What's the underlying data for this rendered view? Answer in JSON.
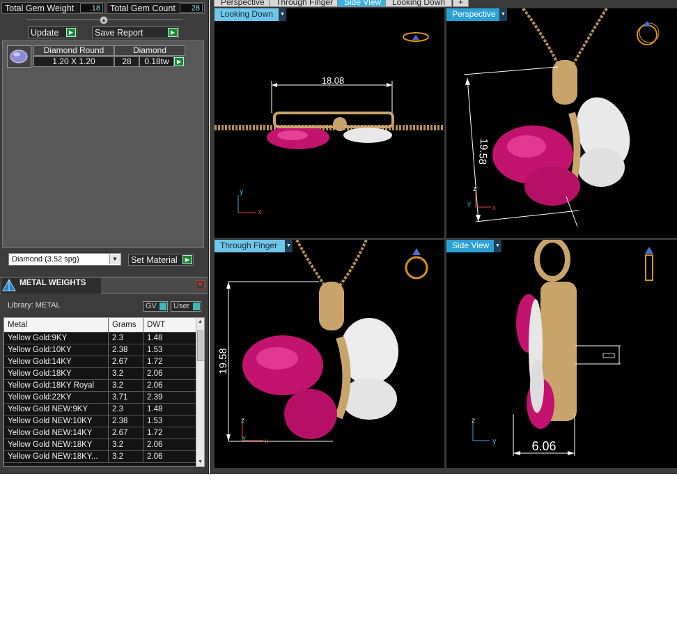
{
  "stats": {
    "total_weight_label": "Total Gem Weight",
    "total_weight_value": ".18",
    "total_count_label": "Total Gem Count",
    "total_count_value": "28"
  },
  "buttons": {
    "update": "Update",
    "save_report": "Save Report",
    "set_material": "Set Material"
  },
  "gem": {
    "shape": "Diamond Round",
    "type": "Diamond",
    "size": "1.20 X 1.20",
    "count": "28",
    "weight": "0.18tw"
  },
  "material_select": {
    "value": "Diamond     (3.52 spg)"
  },
  "metal_weights": {
    "title": "METAL WEIGHTS",
    "library_label": "Library: METAL",
    "gv_label": "GV",
    "user_label": "User",
    "columns": [
      "Metal",
      "Grams",
      "DWT"
    ],
    "rows": [
      {
        "metal": "Yellow Gold:9KY",
        "grams": "2.3",
        "dwt": "1.48"
      },
      {
        "metal": "Yellow Gold:10KY",
        "grams": "2.38",
        "dwt": "1.53"
      },
      {
        "metal": "Yellow Gold:14KY",
        "grams": "2.67",
        "dwt": "1.72"
      },
      {
        "metal": "Yellow Gold:18KY",
        "grams": "3.2",
        "dwt": "2.06"
      },
      {
        "metal": "Yellow Gold:18KY Royal",
        "grams": "3.2",
        "dwt": "2.06"
      },
      {
        "metal": "Yellow Gold:22KY",
        "grams": "3.71",
        "dwt": "2.39"
      },
      {
        "metal": "Yellow Gold NEW:9KY",
        "grams": "2.3",
        "dwt": "1.48"
      },
      {
        "metal": "Yellow Gold NEW:10KY",
        "grams": "2.38",
        "dwt": "1.53"
      },
      {
        "metal": "Yellow Gold NEW:14KY",
        "grams": "2.67",
        "dwt": "1.72"
      },
      {
        "metal": "Yellow Gold NEW:18KY",
        "grams": "3.2",
        "dwt": "2.06"
      },
      {
        "metal": "Yellow Gold NEW:18KY...",
        "grams": "3.2",
        "dwt": "2.06"
      }
    ]
  },
  "top_tabs": [
    "Perspective",
    "Through Finger",
    "Side View",
    "Looking Down",
    "+"
  ],
  "active_top_tab": "Side View",
  "viewports": {
    "top_left": {
      "label": "Looking Down",
      "dimension": "18.08"
    },
    "top_right": {
      "label": "Perspective",
      "dimension": "19.58"
    },
    "bottom_left": {
      "label": "Through Finger",
      "dimension": "19.58"
    },
    "bottom_right": {
      "label": "Side View",
      "dimension": "6.06"
    }
  },
  "axes": {
    "x": "x",
    "y": "y",
    "z": "z"
  },
  "colors": {
    "accent": "#39b2e6",
    "gem": "#d9187a",
    "gold": "#c9a46a",
    "go_button": "#1d8a2a",
    "dimension_line": "#ffffff"
  },
  "icons": [
    "dropdown-arrow-icon",
    "play-arrow-icon",
    "ring-orientation-icon",
    "close-icon",
    "metal-weights-icon",
    "collapse-icon"
  ]
}
